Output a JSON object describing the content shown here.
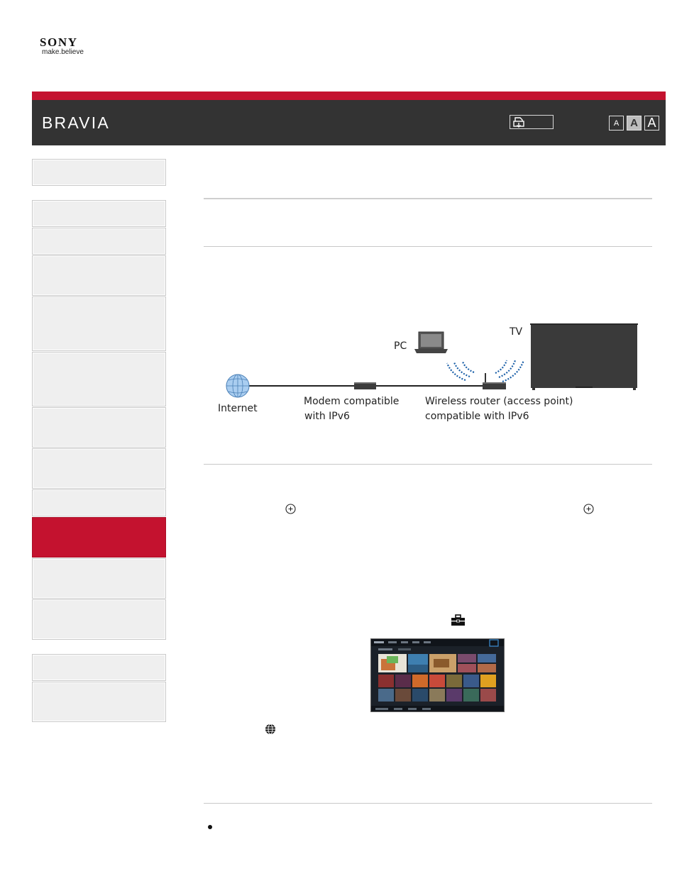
{
  "brand": {
    "name": "SONY",
    "tagline": "make.believe",
    "product": "BRAVIA"
  },
  "header": {
    "print_icon": "print-icon",
    "font_sizes": [
      "A",
      "A",
      "A"
    ],
    "selected_font_size": "A"
  },
  "sidebar": {
    "items": 14,
    "active_color": "#c4122f"
  },
  "diagram": {
    "labels": {
      "internet": "Internet",
      "modem_line1": "Modem compatible",
      "modem_line2": "with IPv6",
      "router_line1": "Wireless router (access point)",
      "router_line2": "compatible with IPv6",
      "pc": "PC",
      "tv": "TV"
    }
  },
  "icons": {
    "enter_button": "circle-plus-icon",
    "toolbox": "toolbox-icon",
    "globe": "globe-icon",
    "bullet": "bullet-icon"
  },
  "colors": {
    "header": "#333333",
    "accent_red": "#c4122f"
  }
}
